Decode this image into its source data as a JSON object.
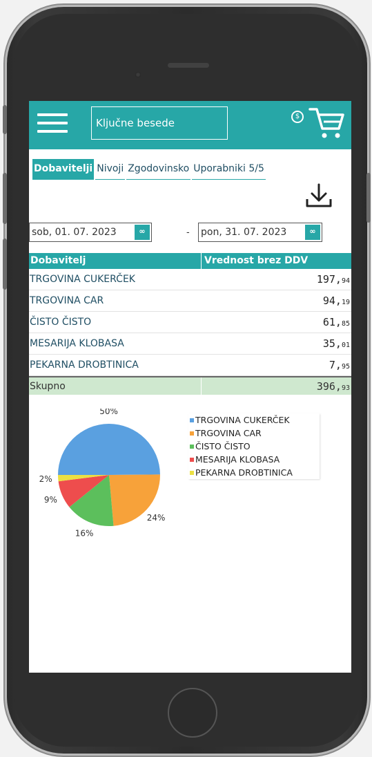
{
  "search": {
    "placeholder": "Ključne besede"
  },
  "header": {
    "coin_symbol": "$",
    "accent": "#27a7a7"
  },
  "tabs": [
    {
      "label": "Dobavitelji",
      "active": true
    },
    {
      "label": "Nivoji",
      "active": false
    },
    {
      "label": "Zgodovinsko",
      "active": false
    },
    {
      "label": "Uporabniki 5/5",
      "active": false
    }
  ],
  "filters": {
    "date_from": "sob, 01. 07. 2023",
    "date_to": "pon, 31. 07. 2023",
    "date_button": "∞",
    "separator": "-"
  },
  "table": {
    "columns": [
      "Dobavitelj",
      "Vrednost brez DDV"
    ],
    "rows": [
      {
        "name": "TRGOVINA CUKERČEK",
        "value_int": "197,",
        "value_dec": "94"
      },
      {
        "name": "TRGOVINA CAR",
        "value_int": "94,",
        "value_dec": "19"
      },
      {
        "name": "ČISTO ČISTO",
        "value_int": "61,",
        "value_dec": "85"
      },
      {
        "name": "MESARIJA KLOBASA",
        "value_int": "35,",
        "value_dec": "01"
      },
      {
        "name": "PEKARNA DROBTINICA",
        "value_int": "7,",
        "value_dec": "95"
      }
    ],
    "total": {
      "label": "Skupno",
      "value_int": "396,",
      "value_dec": "93"
    }
  },
  "chart_data": {
    "type": "pie",
    "slices": [
      {
        "label": "TRGOVINA CUKERČEK",
        "value": 197.94,
        "percent_label": "50%",
        "color": "#5aa0e0"
      },
      {
        "label": "TRGOVINA CAR",
        "value": 94.19,
        "percent_label": "24%",
        "color": "#f7a23a"
      },
      {
        "label": "ČISTO ČISTO",
        "value": 61.85,
        "percent_label": "16%",
        "color": "#5cbf5c"
      },
      {
        "label": "MESARIJA KLOBASA",
        "value": 35.01,
        "percent_label": "9%",
        "color": "#ee4d4d"
      },
      {
        "label": "PEKARNA DROBTINICA",
        "value": 7.95,
        "percent_label": "2%",
        "color": "#ece042"
      }
    ],
    "legend": [
      "TRGOVINA CUKERČEK",
      "TRGOVINA CAR",
      "ČISTO ČISTO",
      "MESARIJA KLOBASA",
      "PEKARNA DROBTINICA"
    ],
    "legend_position": "right"
  }
}
